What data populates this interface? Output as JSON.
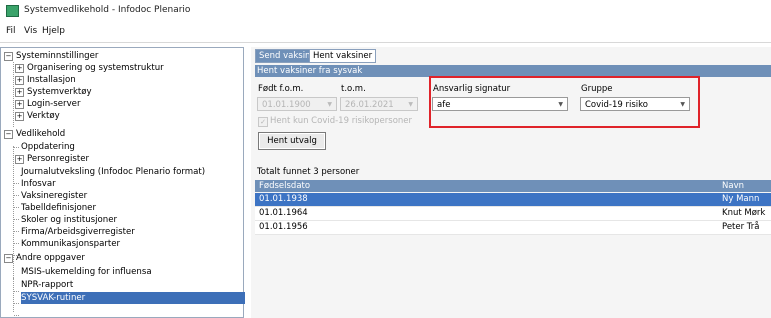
{
  "window": {
    "title": "Systemvedlikehold - Infodoc Plenario"
  },
  "menu": [
    "Fil",
    "Vis",
    "Hjelp"
  ],
  "tree": [
    {
      "label": "Systeminnstillinger",
      "expander": "−"
    },
    {
      "label": "Organisering og systemstruktur",
      "expander": "+"
    },
    {
      "label": "Installasjon",
      "expander": "+"
    },
    {
      "label": "Systemverktøy",
      "expander": "+"
    },
    {
      "label": "Login-server",
      "expander": "+"
    },
    {
      "label": "Verktøy",
      "expander": "+"
    },
    {
      "label": "Vedlikehold",
      "expander": "−"
    },
    {
      "label": "Oppdatering"
    },
    {
      "label": "Personregister",
      "expander": "+"
    },
    {
      "label": "Journalutveksling (Infodoc Plenario format)"
    },
    {
      "label": "Infosvar"
    },
    {
      "label": "Vaksineregister"
    },
    {
      "label": "Tabelldefinisjoner"
    },
    {
      "label": "Skoler og institusjoner"
    },
    {
      "label": "Firma/Arbeidsgiverregister"
    },
    {
      "label": "Kommunikasjonsparter"
    },
    {
      "label": "Andre oppgaver",
      "expander": "−"
    },
    {
      "label": "MSIS-ukemelding for influensa"
    },
    {
      "label": "NPR-rapport"
    },
    {
      "label": "SYSVAK-rutiner"
    }
  ],
  "tabs": {
    "send": "Send vaksiner",
    "fetch": "Hent vaksiner"
  },
  "section_title": "Hent vaksiner fra sysvak",
  "form": {
    "from_label": "Født f.o.m.",
    "from_value": "01.01.1900",
    "to_label": "t.o.m.",
    "to_value": "26.01.2021",
    "checkbox_label": "Hent kun Covid-19 risikopersoner",
    "checkbox_mark": "✓",
    "signature_label": "Ansvarlig signatur",
    "signature_value": "afe",
    "group_label": "Gruppe",
    "group_value": "Covid-19 risiko",
    "fetch_button": "Hent utvalg"
  },
  "results": {
    "summary": "Totalt funnet 3 personer",
    "columns": [
      "Fødselsdato",
      "Navn"
    ],
    "rows": [
      {
        "dob": "01.01.1938",
        "name": "Ny Mann"
      },
      {
        "dob": "01.01.1964",
        "name": "Knut Mørk"
      },
      {
        "dob": "01.01.1956",
        "name": "Peter Trå"
      }
    ]
  },
  "colors": {
    "accent": "#6f90b8",
    "selection": "#3d74c4",
    "highlight": "#e0232a"
  }
}
